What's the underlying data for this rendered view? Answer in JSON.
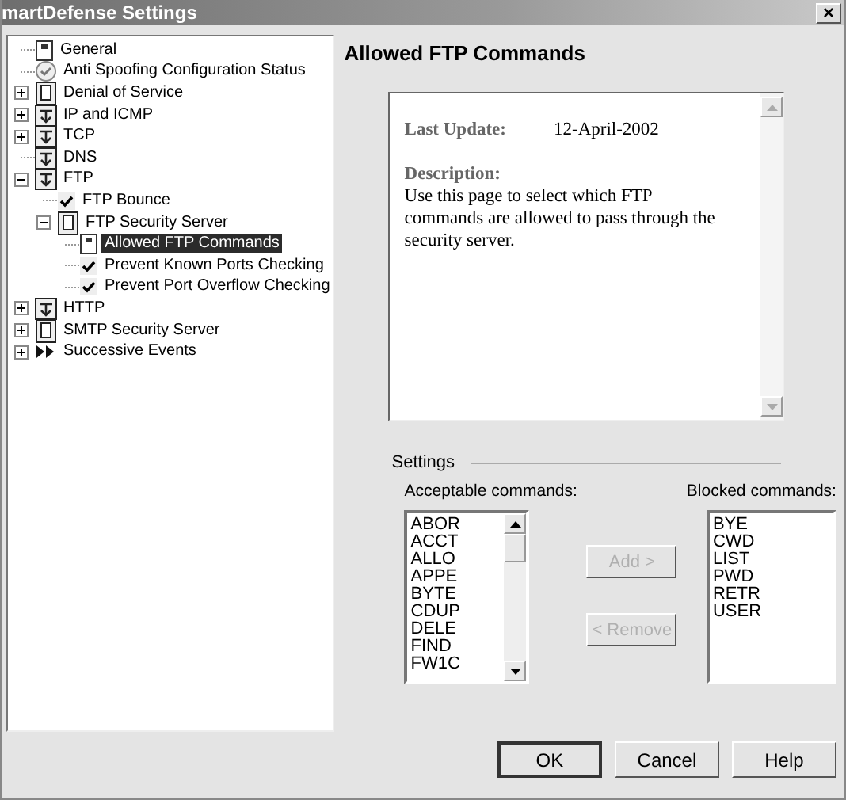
{
  "window": {
    "title": "martDefense Settings",
    "close": "×"
  },
  "tree": [
    {
      "label": "General",
      "kind": "page",
      "selected": false
    },
    {
      "label": "Anti Spoofing Configuration Status",
      "kind": "status",
      "selected": false
    },
    {
      "label": "Denial of Service",
      "kind": "doc",
      "expanded": false,
      "selected": false
    },
    {
      "label": "IP and ICMP",
      "kind": "filter",
      "expanded": false,
      "selected": false
    },
    {
      "label": "TCP",
      "kind": "filter",
      "expanded": false,
      "selected": false
    },
    {
      "label": "DNS",
      "kind": "filter",
      "selected": false
    },
    {
      "label": "FTP",
      "kind": "filter",
      "expanded": true,
      "selected": false,
      "children": [
        {
          "label": "FTP Bounce",
          "kind": "check",
          "checked": true,
          "selected": false
        },
        {
          "label": "FTP Security Server",
          "kind": "doc",
          "expanded": true,
          "selected": false,
          "children": [
            {
              "label": "Allowed FTP Commands",
              "kind": "page",
              "selected": true
            },
            {
              "label": "Prevent Known Ports Checking",
              "kind": "check",
              "checked": true,
              "selected": false
            },
            {
              "label": "Prevent Port Overflow Checking",
              "kind": "check",
              "checked": true,
              "selected": false
            }
          ]
        }
      ]
    },
    {
      "label": "HTTP",
      "kind": "filter",
      "expanded": false,
      "selected": false
    },
    {
      "label": "SMTP Security Server",
      "kind": "doc",
      "expanded": false,
      "selected": false
    },
    {
      "label": "Successive Events",
      "kind": "arrows",
      "expanded": false,
      "selected": false
    }
  ],
  "page_title": "Allowed FTP Commands",
  "info": {
    "last_update_label": "Last Update:",
    "last_update": "12-April-2002",
    "description_label": "Description:",
    "description": "Use this page to select which FTP commands are allowed to pass through the security server."
  },
  "settings": {
    "label": "Settings",
    "acceptable": {
      "label": "Acceptable commands:",
      "items": [
        "ABOR",
        "ACCT",
        "ALLO",
        "APPE",
        "BYTE",
        "CDUP",
        "DELE",
        "FIND",
        "FW1C"
      ]
    },
    "add": {
      "label": "Add >",
      "disabled": true
    },
    "remove": {
      "label": "< Remove",
      "disabled": true
    },
    "blocked": {
      "label": "Blocked commands:",
      "items": [
        "BYE",
        "CWD",
        "LIST",
        "PWD",
        "RETR",
        "USER"
      ]
    }
  },
  "buttons": [
    {
      "label": "OK",
      "default": true
    },
    {
      "label": "Cancel",
      "default": false
    },
    {
      "label": "Help",
      "default": false
    }
  ]
}
